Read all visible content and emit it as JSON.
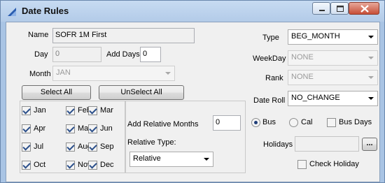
{
  "window": {
    "title": "Date Rules"
  },
  "fields": {
    "name_label": "Name",
    "name_value": "SOFR 1M First",
    "day_label": "Day",
    "day_value": "0",
    "add_days_label": "Add Days",
    "add_days_value": "0",
    "month_label": "Month",
    "month_value": "JAN",
    "type_label": "Type",
    "type_value": "BEG_MONTH",
    "weekday_label": "WeekDay",
    "weekday_value": "NONE",
    "rank_label": "Rank",
    "rank_value": "NONE",
    "date_roll_label": "Date Roll",
    "date_roll_value": "NO_CHANGE",
    "add_rel_months_label": "Add Relative Months",
    "add_rel_months_value": "0",
    "rel_type_label": "Relative Type:",
    "rel_type_value": "Relative",
    "holidays_label": "Holidays",
    "holidays_value": "",
    "browse_label": "..."
  },
  "buttons": {
    "select_all": "Select All",
    "unselect_all": "UnSelect All"
  },
  "months": [
    {
      "label": "Jan",
      "checked": true
    },
    {
      "label": "Feb",
      "checked": true
    },
    {
      "label": "Mar",
      "checked": true
    },
    {
      "label": "Apr",
      "checked": true
    },
    {
      "label": "May",
      "checked": true
    },
    {
      "label": "Jun",
      "checked": true
    },
    {
      "label": "Jul",
      "checked": true
    },
    {
      "label": "Aug",
      "checked": true
    },
    {
      "label": "Sep",
      "checked": true
    },
    {
      "label": "Oct",
      "checked": true
    },
    {
      "label": "Nov",
      "checked": true
    },
    {
      "label": "Dec",
      "checked": true
    }
  ],
  "day_mode": {
    "bus": "Bus",
    "cal": "Cal",
    "selected": "Bus"
  },
  "options": {
    "bus_days": "Bus Days",
    "bus_days_checked": false,
    "check_holiday": "Check Holiday",
    "check_holiday_checked": false
  }
}
